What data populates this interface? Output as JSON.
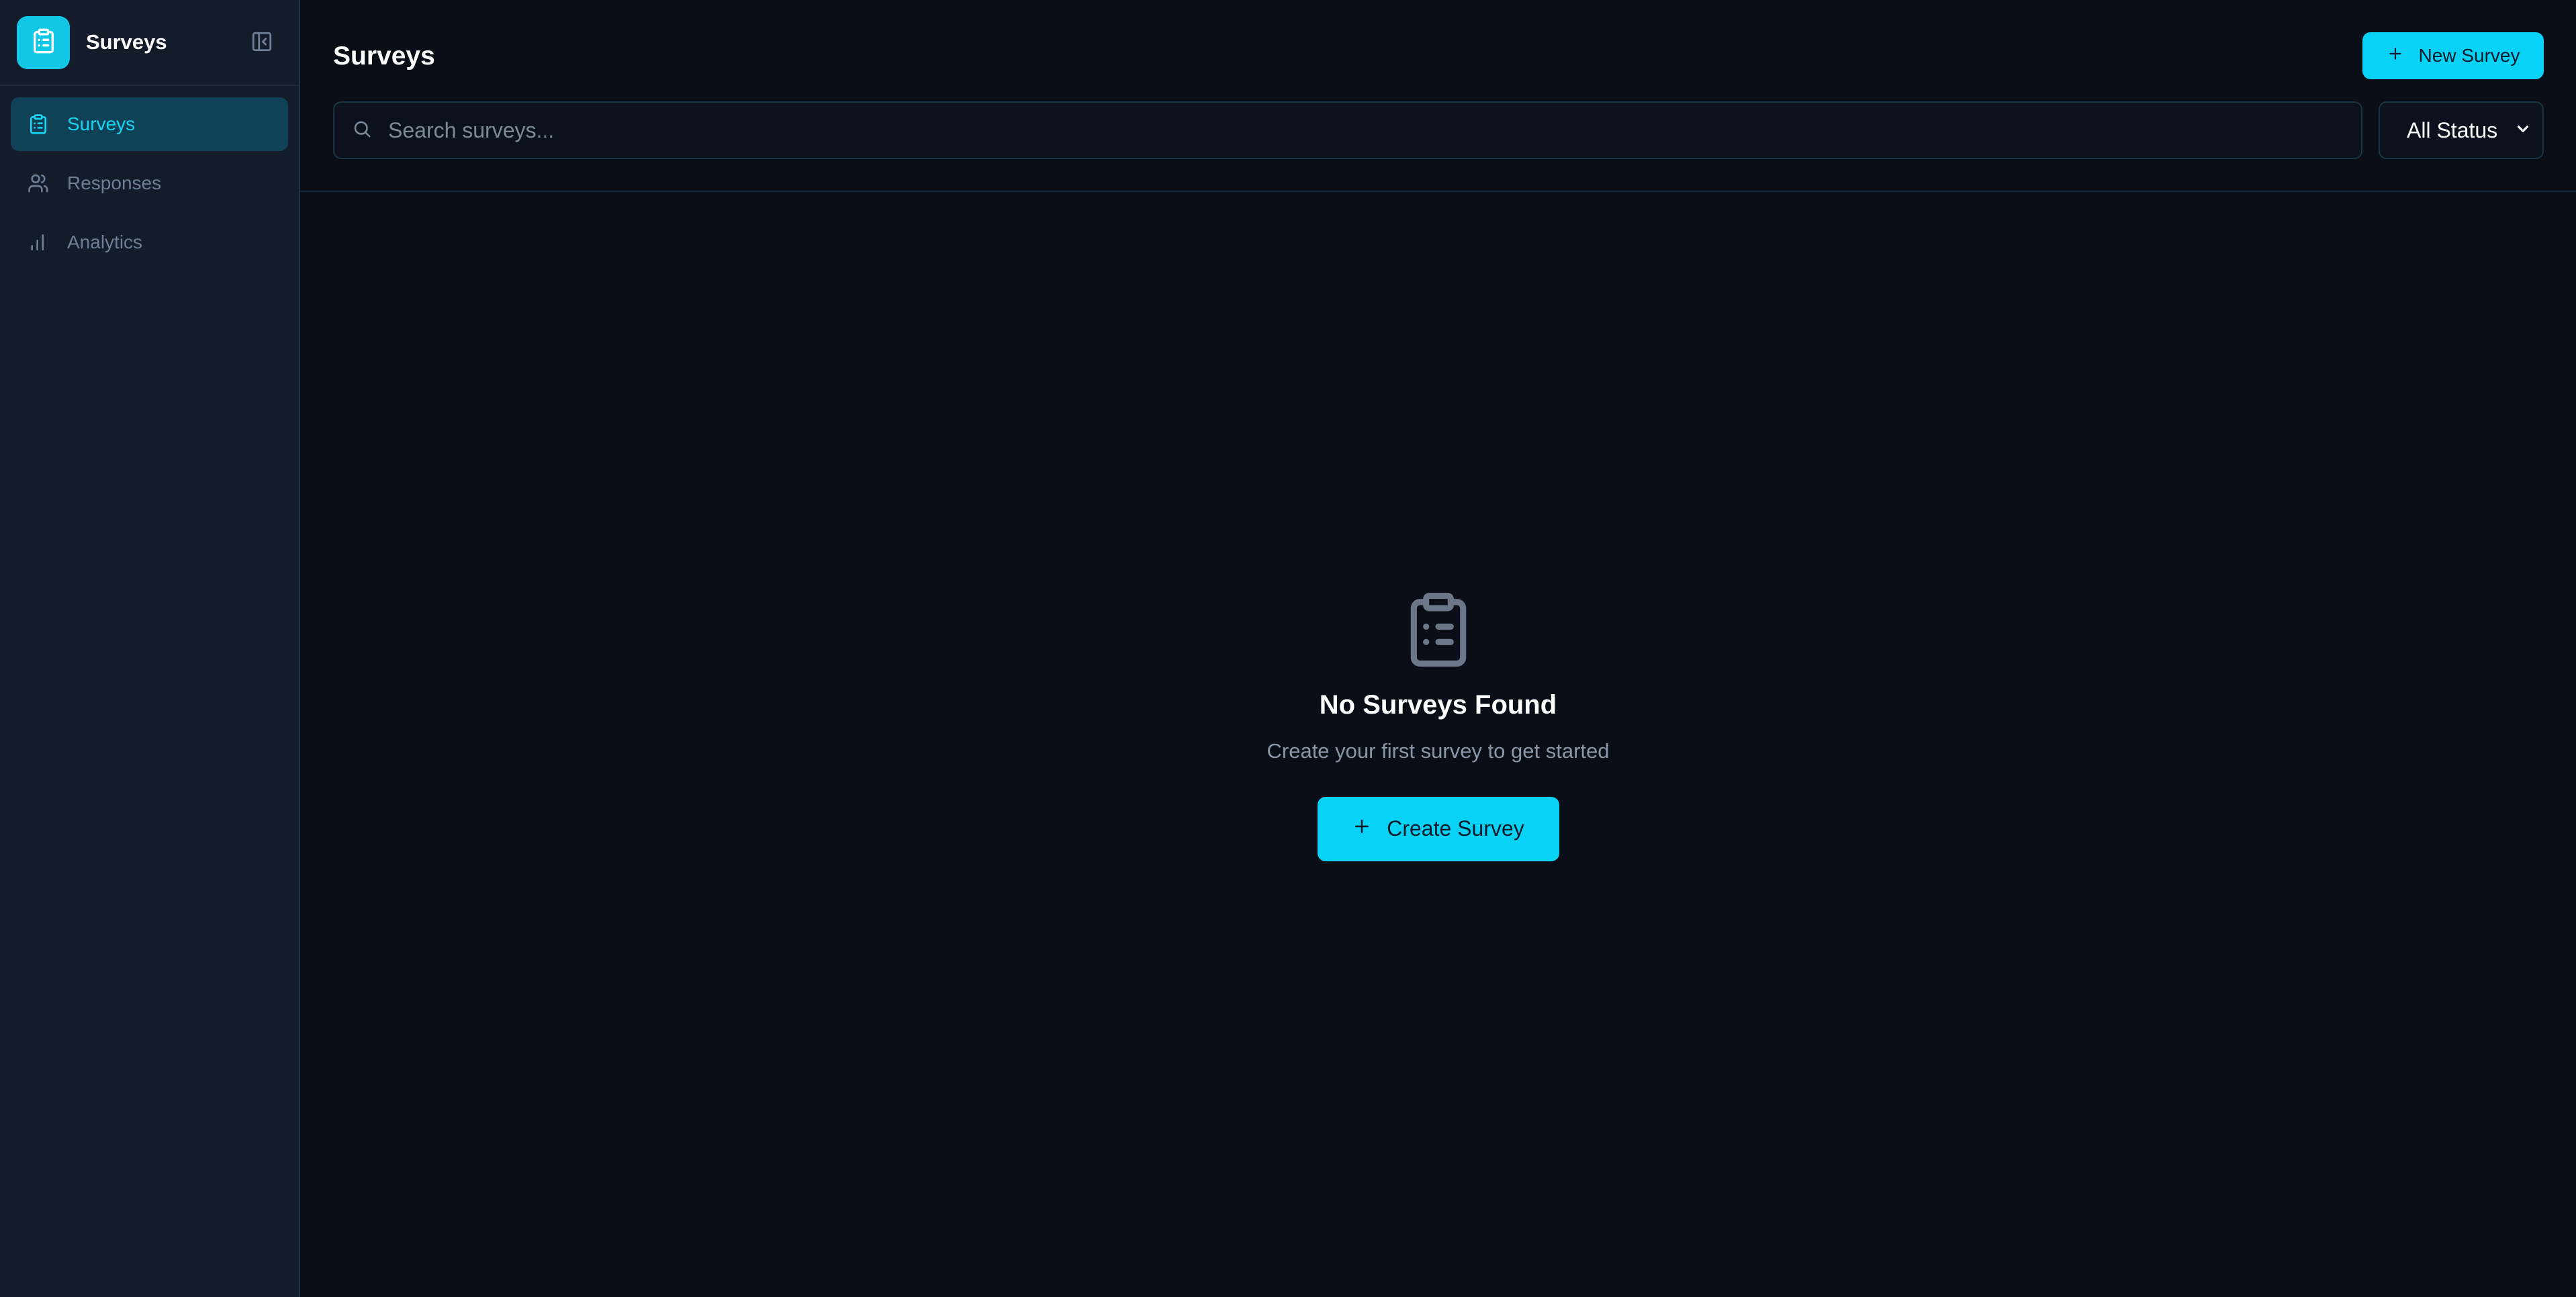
{
  "colors": {
    "accent": "#08d3f6",
    "sidebar_bg": "#141b2b",
    "main_bg": "#0a0e17",
    "active_nav_bg": "#104257",
    "active_nav_text": "#19d3f0",
    "muted_text": "#6e7f95"
  },
  "sidebar": {
    "app_name": "Surveys",
    "app_icon": "clipboard-list-icon",
    "collapse_icon": "sidebar-collapse-icon",
    "items": [
      {
        "label": "Surveys",
        "icon": "clipboard-list-icon",
        "active": true
      },
      {
        "label": "Responses",
        "icon": "users-icon",
        "active": false
      },
      {
        "label": "Analytics",
        "icon": "bar-chart-icon",
        "active": false
      }
    ]
  },
  "header": {
    "title": "Surveys",
    "new_button_label": "New Survey"
  },
  "search": {
    "placeholder": "Search surveys...",
    "value": ""
  },
  "filter": {
    "selected": "All Status"
  },
  "empty_state": {
    "icon": "clipboard-list-icon",
    "title": "No Surveys Found",
    "subtitle": "Create your first survey to get started",
    "button_label": "Create Survey"
  }
}
